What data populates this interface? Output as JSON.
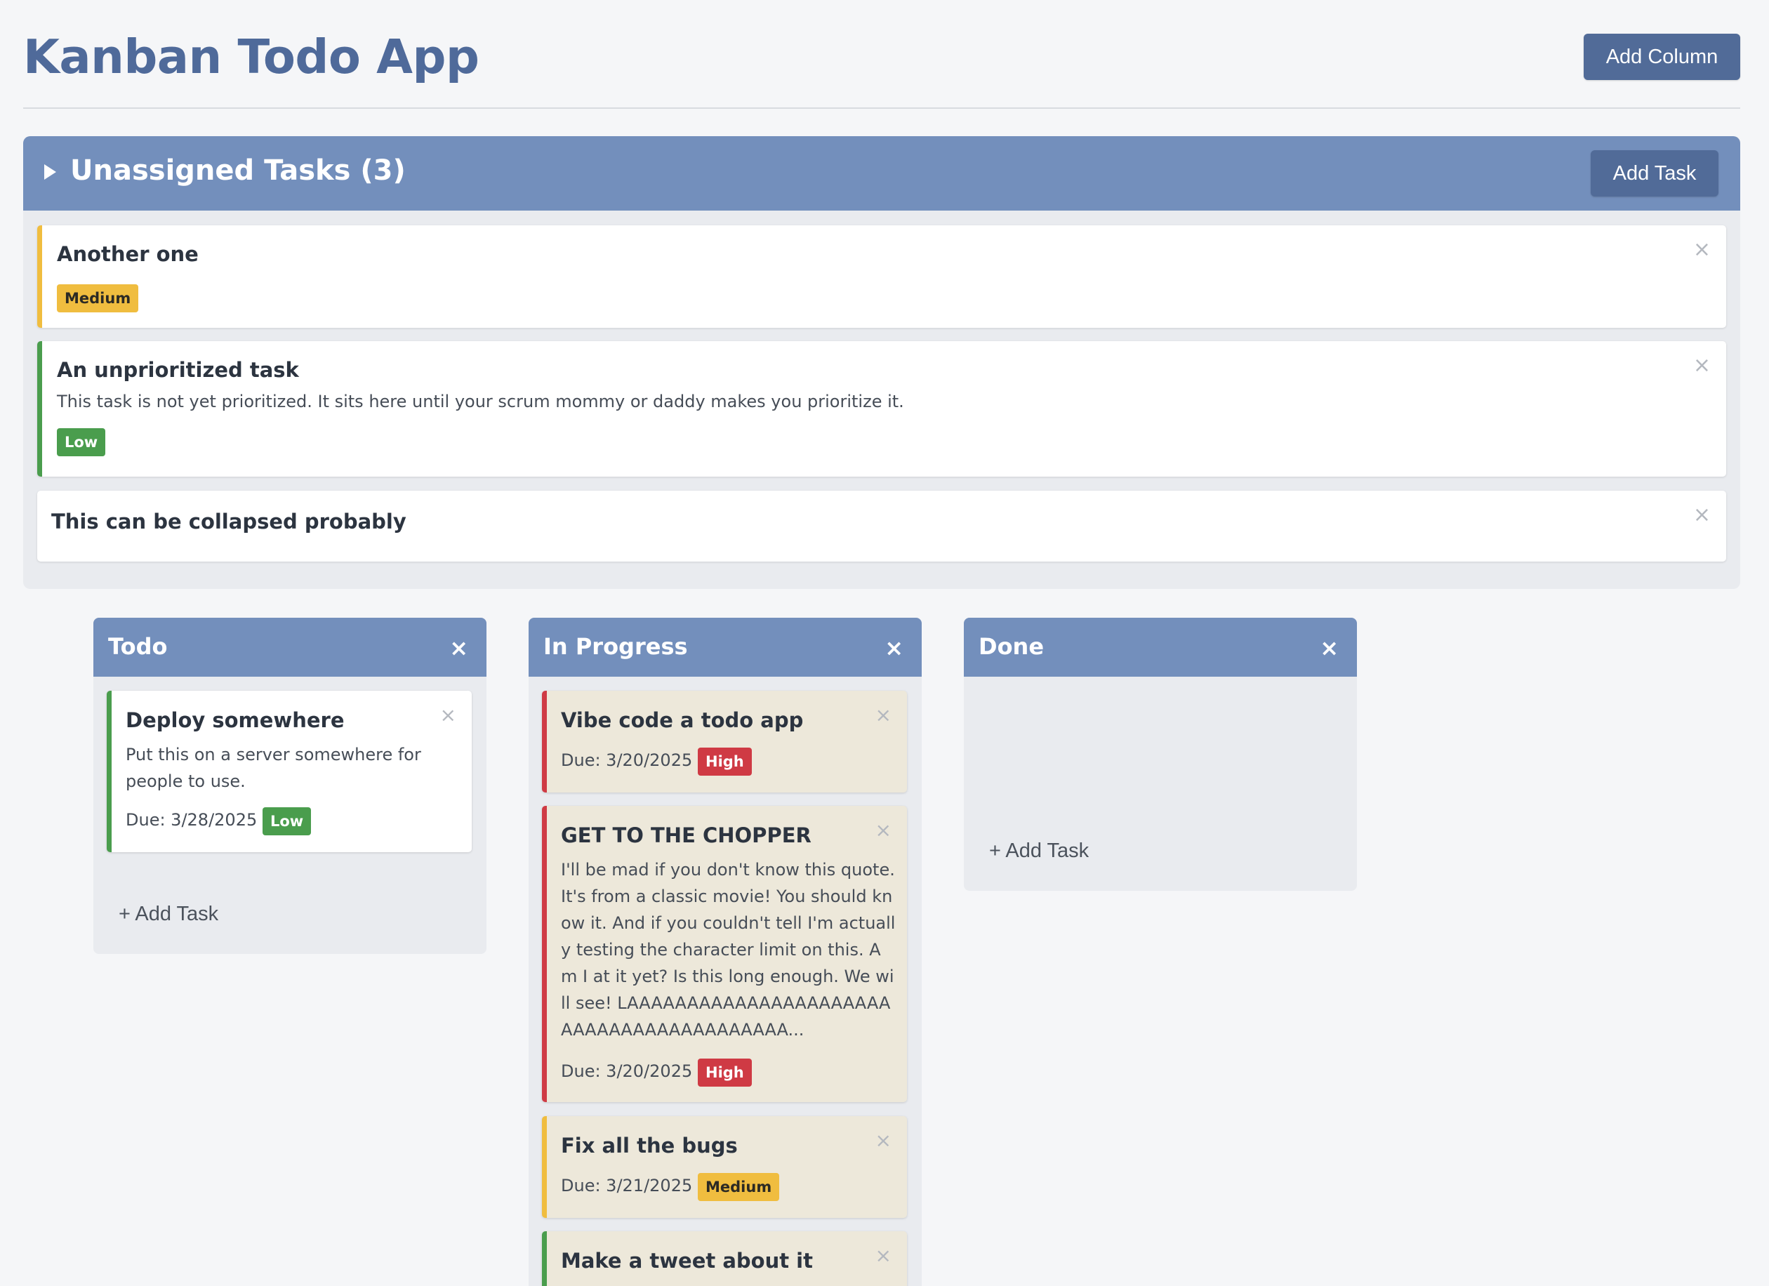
{
  "header": {
    "title": "Kanban Todo App",
    "add_column_label": "Add Column"
  },
  "unassigned": {
    "title": "Unassigned Tasks (3)",
    "add_task_label": "Add Task",
    "tasks": [
      {
        "title": "Another one",
        "priority": "Medium",
        "close": "×"
      },
      {
        "title": "An unprioritized task",
        "description": "This task is not yet prioritized. It sits here until your scrum mommy or daddy makes you prioritize it.",
        "priority": "Low",
        "close": "×"
      },
      {
        "title": "This can be collapsed probably",
        "close": "×"
      }
    ]
  },
  "columns": [
    {
      "title": "Todo",
      "close": "×",
      "add_task": "+ Add Task",
      "tasks": [
        {
          "title": "Deploy somewhere",
          "description": "Put this on a server somewhere for people to use.",
          "due": "Due: 3/28/2025",
          "priority": "Low",
          "close": "×"
        }
      ]
    },
    {
      "title": "In Progress",
      "close": "×",
      "tasks": [
        {
          "title": "Vibe code a todo app",
          "due": "Due: 3/20/2025",
          "priority": "High",
          "close": "×"
        },
        {
          "title": "GET TO THE CHOPPER",
          "description": "I'll be mad if you don't know this quote. It's from a classic movie! You should know it. And if you couldn't tell I'm actually testing the character limit on this. Am I at it yet? Is this long enough. We will see! LAAAAAAAAAAAAAAAAAAAAAAAAAAAAAAAAAAAAAAAAA...",
          "due": "Due: 3/20/2025",
          "priority": "High",
          "close": "×"
        },
        {
          "title": "Fix all the bugs",
          "due": "Due: 3/21/2025",
          "priority": "Medium",
          "close": "×"
        },
        {
          "title": "Make a tweet about it",
          "close": "×"
        }
      ]
    },
    {
      "title": "Done",
      "close": "×",
      "add_task": "+ Add Task",
      "tasks": []
    }
  ],
  "colors": {
    "accent": "#738fbc",
    "button": "#516b98",
    "title": "#4f6a9a",
    "priority_high": "#cf3a44",
    "priority_medium": "#f0bd3f",
    "priority_low": "#4a9d4d"
  }
}
